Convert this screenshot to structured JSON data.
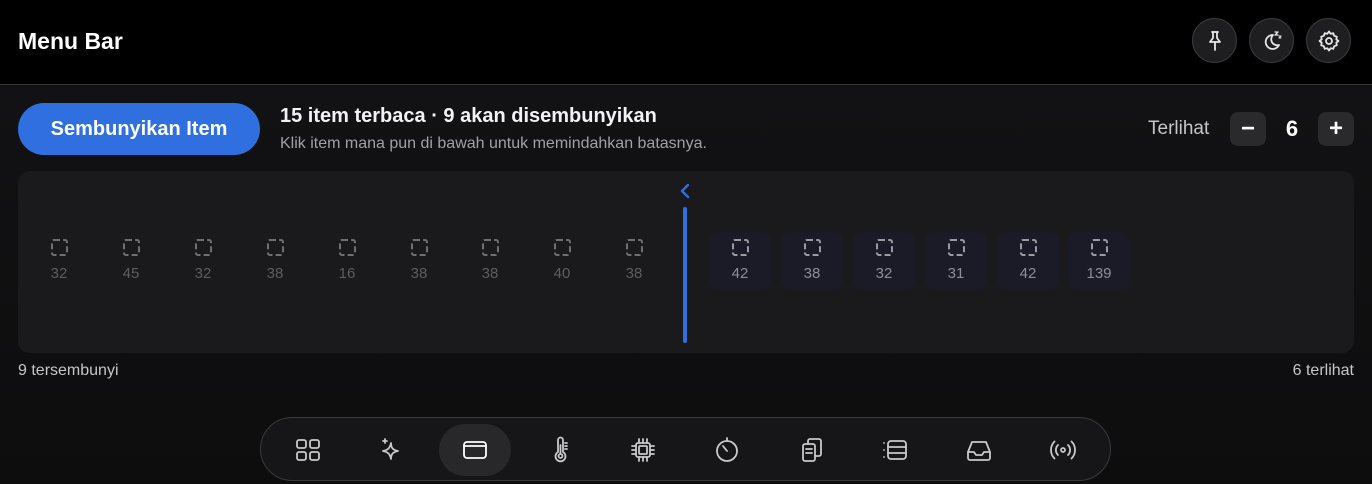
{
  "header": {
    "title": "Menu Bar",
    "actions": [
      {
        "name": "pin-button",
        "icon": "pin-icon"
      },
      {
        "name": "sleep-button",
        "icon": "moon-zzz-icon"
      },
      {
        "name": "settings-button",
        "icon": "gear-icon"
      }
    ]
  },
  "actions": {
    "hide_button_label": "Sembunyikan Item"
  },
  "summary": {
    "headline": "15 item terbaca · 9 akan disembunyikan",
    "hint": "Klik item mana pun di bawah untuk memindahkan batasnya."
  },
  "visible_control": {
    "label": "Terlihat",
    "decrement": "−",
    "increment": "+",
    "value": "6"
  },
  "items": [
    {
      "width": "32",
      "state": "hidden"
    },
    {
      "width": "45",
      "state": "hidden"
    },
    {
      "width": "32",
      "state": "hidden"
    },
    {
      "width": "38",
      "state": "hidden"
    },
    {
      "width": "16",
      "state": "hidden"
    },
    {
      "width": "38",
      "state": "hidden"
    },
    {
      "width": "38",
      "state": "hidden"
    },
    {
      "width": "40",
      "state": "hidden"
    },
    {
      "width": "38",
      "state": "hidden"
    },
    {
      "width": "42",
      "state": "shown"
    },
    {
      "width": "38",
      "state": "shown"
    },
    {
      "width": "32",
      "state": "shown"
    },
    {
      "width": "31",
      "state": "shown"
    },
    {
      "width": "42",
      "state": "shown"
    },
    {
      "width": "139",
      "state": "shown"
    }
  ],
  "footer": {
    "hidden_count": "9 tersembunyi",
    "visible_count": "6 terlihat"
  },
  "dock": [
    {
      "icon": "grid-icon",
      "active": false
    },
    {
      "icon": "sparkles-icon",
      "active": false
    },
    {
      "icon": "window-icon",
      "active": true
    },
    {
      "icon": "thermometer-icon",
      "active": false
    },
    {
      "icon": "cpu-icon",
      "active": false
    },
    {
      "icon": "timer-icon",
      "active": false
    },
    {
      "icon": "documents-icon",
      "active": false
    },
    {
      "icon": "list-panel-icon",
      "active": false
    },
    {
      "icon": "tray-icon",
      "active": false
    },
    {
      "icon": "broadcast-icon",
      "active": false
    }
  ],
  "colors": {
    "accent": "#2f6fe0",
    "background": "#0c0c0d",
    "header": "#000000"
  }
}
